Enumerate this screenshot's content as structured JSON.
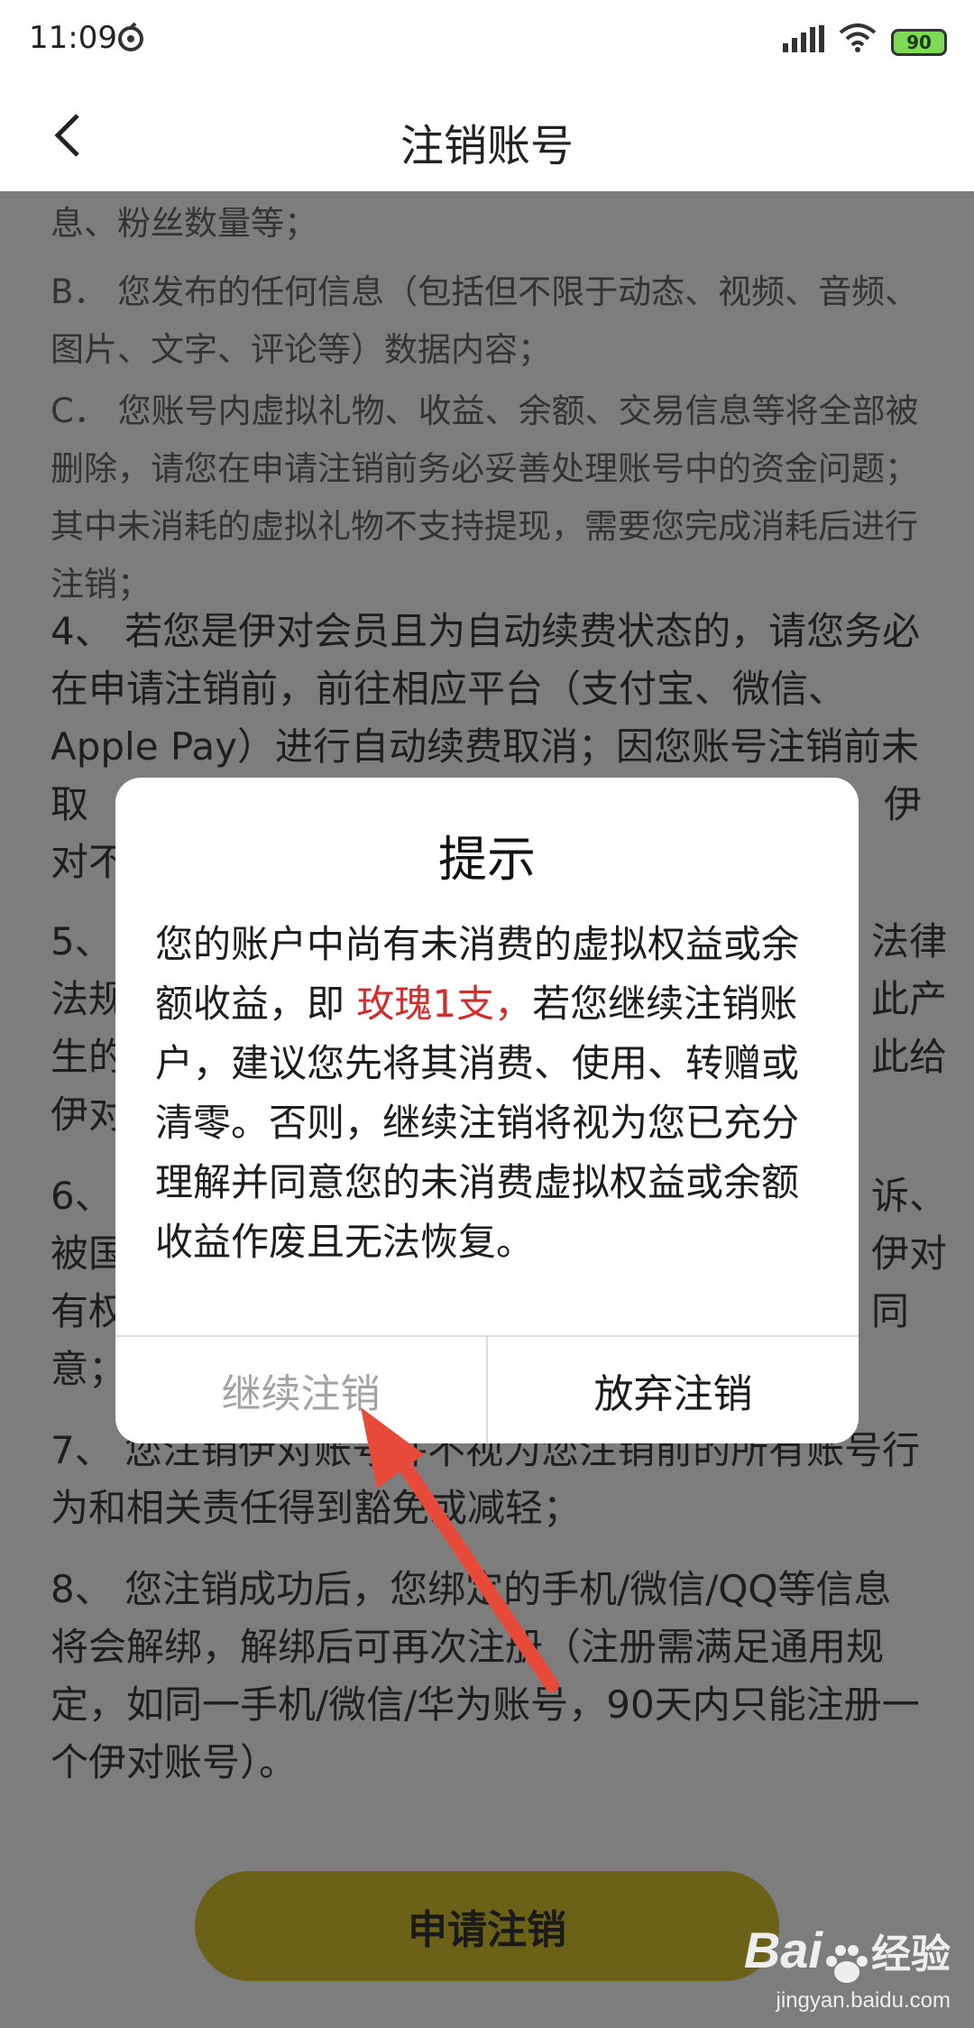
{
  "status_bar": {
    "time": "11:09",
    "battery": "90",
    "icons": [
      "app-notification-icon",
      "signal-icon",
      "wifi-icon",
      "battery-icon"
    ]
  },
  "nav": {
    "title": "注销账号",
    "back_icon": "chevron-left-icon"
  },
  "content": {
    "paragraphs": [
      "息、粉丝数量等；",
      "B． 您发布的任何信息（包括但不限于动态、视频、音频、图片、文字、评论等）数据内容；",
      "C． 您账号内虚拟礼物、收益、余额、交易信息等将全部被删除，请您在申请注销前务必妥善处理账号中的资金问题；其中未消耗的虚拟礼物不支持提现，需要您完成消耗后进行注销；",
      "4、 若您是伊对会员且为自动续费状态的，请您务必在申请注销前，前往相应平台（支付宝、微信、Apple Pay）进行自动续费取消；因您账号注销前未取",
      "伊",
      "对不",
      "5、",
      "法律",
      "法规",
      "此产",
      "生的",
      "此给",
      "伊对",
      "6、",
      "诉、",
      "被国",
      "伊对",
      "有权",
      "同",
      "意；",
      "7、 您注销伊对账号并不视为您注销前的所有账号行为和相关责任得到豁免或减轻；",
      "8、 您注销成功后，您绑定的手机/微信/QQ等信息将会解绑，解绑后可再次注册（注册需满足通用规定，如同一手机/微信/华为账号，90天内只能注册一个伊对账号）。"
    ],
    "apply_button": "申请注销"
  },
  "dialog": {
    "title": "提示",
    "body_before": "您的账户中尚有未消费的虚拟权益或余额收益，即 ",
    "body_highlight": "玫瑰1支，",
    "body_after": "若您继续注销账户，建议您先将其消费、使用、转赠或清零。否则，继续注销将视为您已充分理解并同意您的未消费虚拟权益或余额收益作废且无法恢复。",
    "continue_button": "继续注销",
    "abandon_button": "放弃注销"
  },
  "watermark": {
    "brand": "Bai",
    "brand_suffix": "经验",
    "url": "jingyan.baidu.com"
  },
  "colors": {
    "overlay": "#7d7d7d",
    "highlight": "#d42b2b",
    "button": "#6b6218",
    "annotation_arrow": "#e84a3a"
  }
}
